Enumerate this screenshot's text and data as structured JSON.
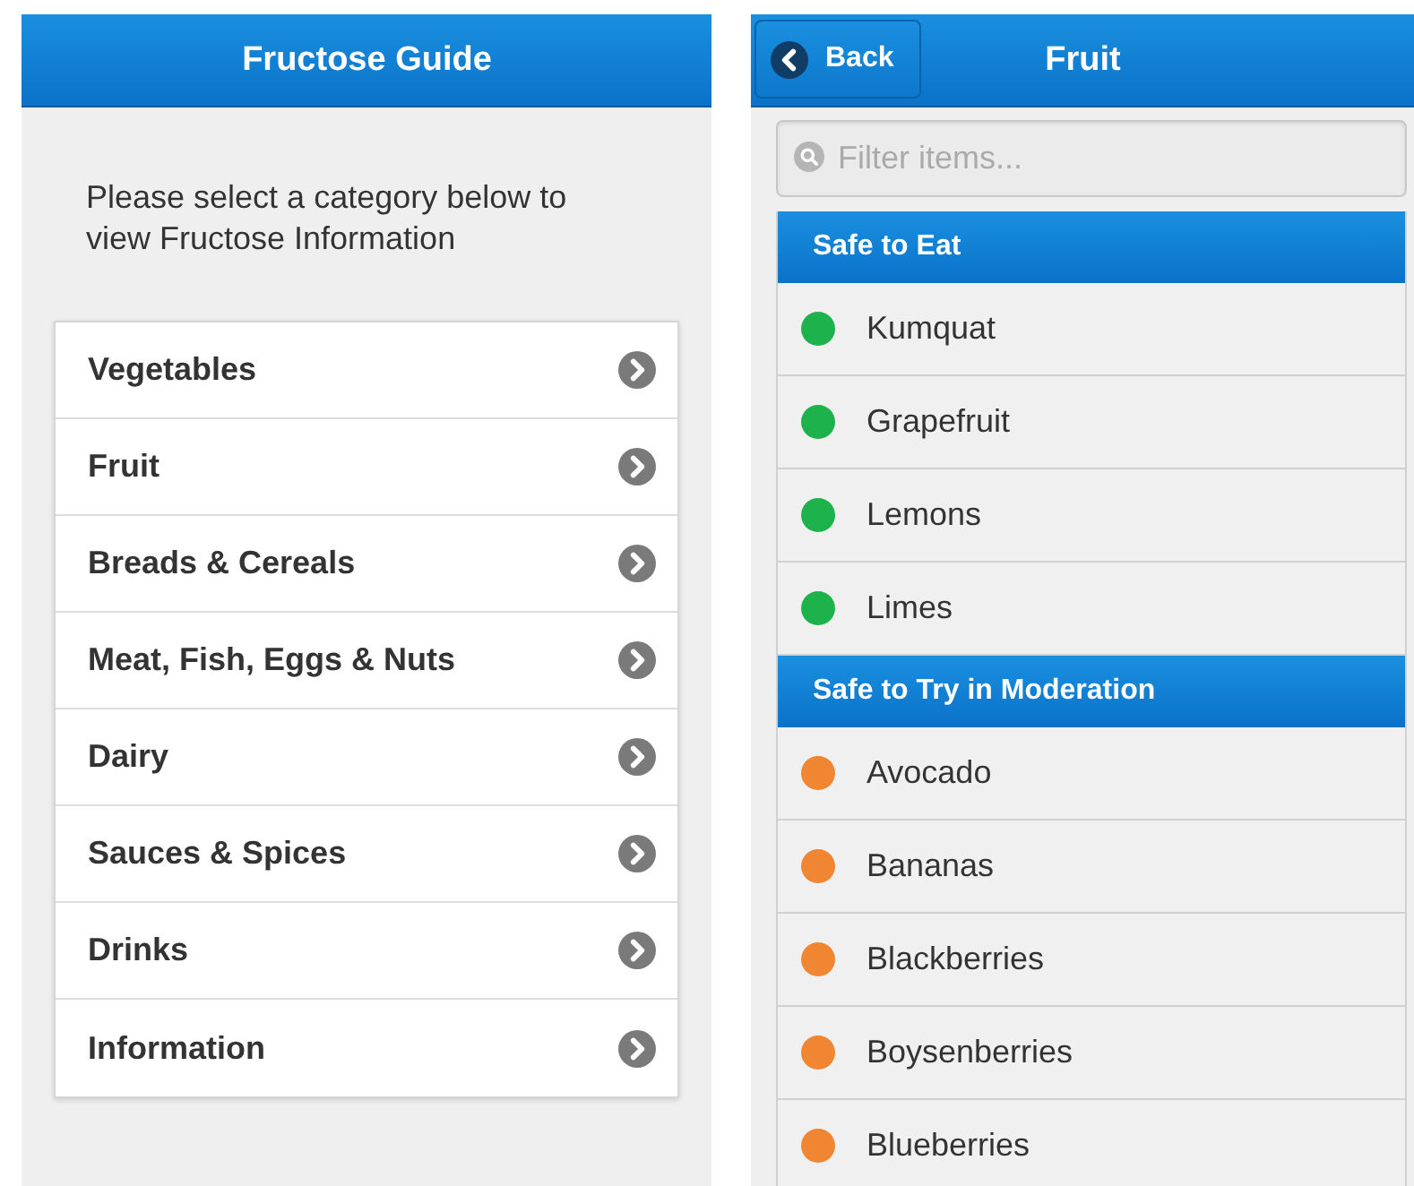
{
  "category_screen": {
    "title": "Fructose Guide",
    "intro": "Please select a category below to view Fructose Information",
    "categories": [
      {
        "label": "Vegetables"
      },
      {
        "label": "Fruit"
      },
      {
        "label": "Breads & Cereals"
      },
      {
        "label": "Meat, Fish, Eggs & Nuts"
      },
      {
        "label": "Dairy"
      },
      {
        "label": "Sauces & Spices"
      },
      {
        "label": "Drinks"
      },
      {
        "label": "Information"
      }
    ]
  },
  "fruit_screen": {
    "back_button": "Back",
    "title": "Fruit",
    "filter": {
      "placeholder": "Filter items..."
    },
    "sections": [
      {
        "heading": "Safe to Eat",
        "items": [
          {
            "name": "Kumquat",
            "color": "#1db24b"
          },
          {
            "name": "Grapefruit",
            "color": "#1db24b"
          },
          {
            "name": "Lemons",
            "color": "#1db24b"
          },
          {
            "name": "Limes",
            "color": "#1db24b"
          }
        ]
      },
      {
        "heading": "Safe to Try in Moderation",
        "items": [
          {
            "name": "Avocado",
            "color": "#f08532"
          },
          {
            "name": "Bananas",
            "color": "#f08532"
          },
          {
            "name": "Blackberries",
            "color": "#f08532"
          },
          {
            "name": "Boysenberries",
            "color": "#f08532"
          },
          {
            "name": "Blueberries",
            "color": "#f08532"
          }
        ]
      }
    ]
  }
}
